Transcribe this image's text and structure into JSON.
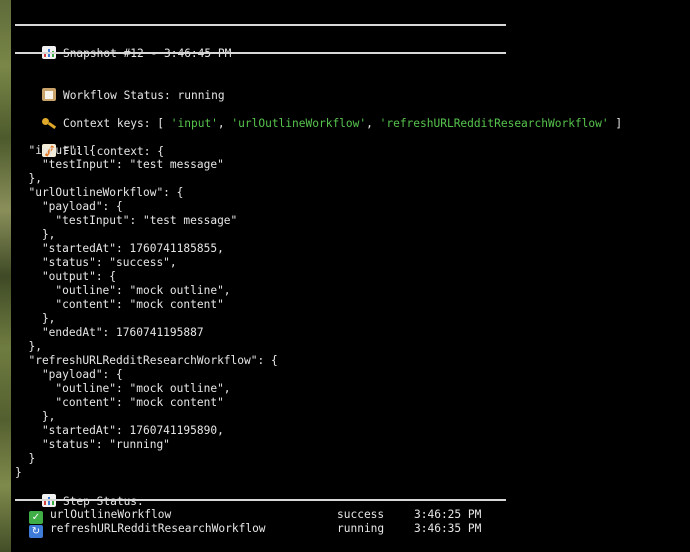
{
  "snapshot": {
    "title": "Snapshot #12 - 3:46:45 PM"
  },
  "workflow_status": {
    "label": "Workflow Status:",
    "value": "running"
  },
  "context_keys": {
    "label": "Context keys:",
    "open": "[",
    "keys": [
      "'input'",
      "'urlOutlineWorkflow'",
      "'refreshURLRedditResearchWorkflow'"
    ],
    "close": "]"
  },
  "full_context": {
    "label": "Full context: {",
    "lines": [
      "  \"input\": {",
      "    \"testInput\": \"test message\"",
      "  },",
      "  \"urlOutlineWorkflow\": {",
      "    \"payload\": {",
      "      \"testInput\": \"test message\"",
      "    },",
      "    \"startedAt\": 1760741185855,",
      "    \"status\": \"success\",",
      "    \"output\": {",
      "      \"outline\": \"mock outline\",",
      "      \"content\": \"mock content\"",
      "    },",
      "    \"endedAt\": 1760741195887",
      "  },",
      "  \"refreshURLRedditResearchWorkflow\": {",
      "    \"payload\": {",
      "      \"outline\": \"mock outline\",",
      "      \"content\": \"mock content\"",
      "    },",
      "    \"startedAt\": 1760741195890,",
      "    \"status\": \"running\"",
      "  }",
      "}"
    ]
  },
  "step_status": {
    "label": "Step Status:",
    "rows": [
      {
        "icon": "check-icon",
        "name": "urlOutlineWorkflow",
        "status": "success",
        "time": "3:46:25 PM"
      },
      {
        "icon": "refresh-icon",
        "name": "refreshURLRedditResearchWorkflow",
        "status": "running",
        "time": "3:46:35 PM"
      }
    ]
  },
  "colors": {
    "background": "#000000",
    "text": "#e6e6e6",
    "string_green": "#57c44d",
    "rule": "#d8d8d8"
  }
}
